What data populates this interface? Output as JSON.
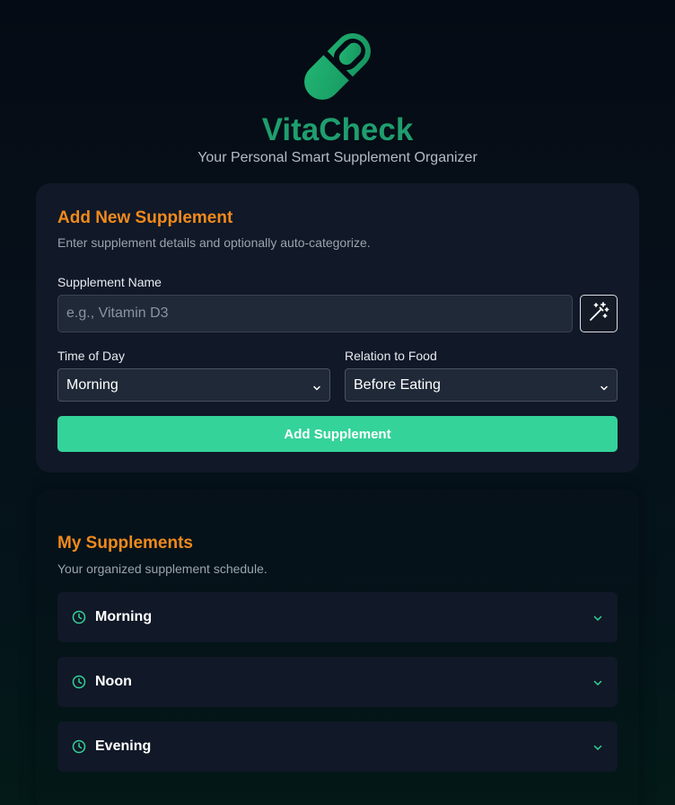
{
  "app": {
    "title": "VitaCheck",
    "subtitle": "Your Personal Smart Supplement Organizer"
  },
  "add_form": {
    "title": "Add New Supplement",
    "description": "Enter supplement details and optionally auto-categorize.",
    "name_label": "Supplement Name",
    "name_placeholder": "e.g., Vitamin D3",
    "name_value": "",
    "time_label": "Time of Day",
    "time_value": "Morning",
    "food_label": "Relation to Food",
    "food_value": "Before Eating",
    "submit_label": "Add Supplement"
  },
  "list": {
    "title": "My Supplements",
    "description": "Your organized supplement schedule.",
    "groups": [
      {
        "label": "Morning"
      },
      {
        "label": "Noon"
      },
      {
        "label": "Evening"
      }
    ]
  },
  "icons": {
    "logo": "pill-icon",
    "auto_categorize": "magic-wand-icon",
    "dropdown": "chevron-down-icon",
    "group": "clock-icon"
  },
  "colors": {
    "brand": "#1f9e6e",
    "accent": "#f08a1c",
    "primary_button": "#34d399",
    "card": "#111827"
  }
}
